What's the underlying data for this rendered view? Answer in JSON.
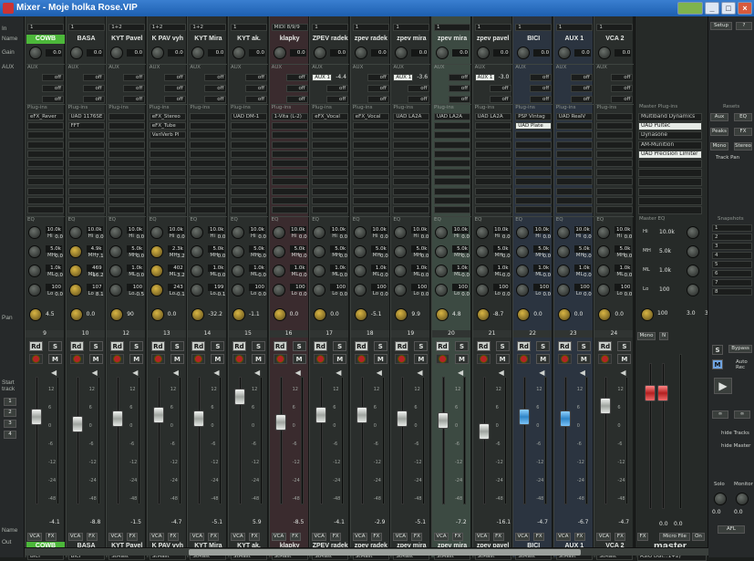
{
  "window": {
    "title": "Mixer - Moje holka Rose.VIP"
  },
  "row_labels": {
    "in": "In",
    "name": "Name",
    "gain": "Gain",
    "aux": "AUX",
    "pan": "Pan",
    "start_track": "Start track",
    "out": "Out",
    "name_bottom": "Name"
  },
  "start_track_numbers": [
    "1",
    "2",
    "3",
    "4"
  ],
  "section_labels": {
    "aux": "AUX",
    "plugins": "Plug-ins",
    "eq": "EQ",
    "master_plugins": "Master Plug-ins",
    "resets": "Resets",
    "master_eq": "Master EQ",
    "snapshots": "Snapshots"
  },
  "channels": [
    {
      "input": "1",
      "name": "COWB",
      "gain": "0.0",
      "aux": [
        "off",
        "off",
        "off"
      ],
      "plugins": [
        "eFX_Rever",
        "",
        ""
      ],
      "eq_vals": [
        "10.0k",
        "5.0k",
        "1.0k",
        "100"
      ],
      "eq_gain": [
        "0.0",
        "0.0",
        "0.0",
        "0.0"
      ],
      "pan": "4.5",
      "num": "9",
      "vol": "-4.1",
      "out": "BICI"
    },
    {
      "input": "1",
      "name": "BASA",
      "gain": "0.0",
      "aux": [
        "off",
        "off",
        "off"
      ],
      "plugins": [
        "UAD 1176SE",
        "FFT",
        ""
      ],
      "eq_vals": [
        "10.0k",
        "4.9k",
        "469",
        "107"
      ],
      "eq_gain": [
        "0.0",
        "7.1",
        "-16.2",
        "8.1"
      ],
      "pan": "0.0",
      "num": "10",
      "vol": "-8.8",
      "out": "BICI"
    },
    {
      "input": "1+2",
      "name": "KYT Pavel",
      "gain": "0.0",
      "aux": [
        "off",
        "off",
        "off"
      ],
      "plugins": [
        "",
        "",
        ""
      ],
      "eq_vals": [
        "10.0k",
        "5.0k",
        "1.0k",
        "100"
      ],
      "eq_gain": [
        "0.0",
        "0.0",
        "0.0",
        "-0.5"
      ],
      "pan": "90",
      "num": "12",
      "vol": "-1.5",
      "out": "StMast"
    },
    {
      "input": "1+2",
      "name": "K PAV vyh",
      "gain": "0.0",
      "aux": [
        "off",
        "off",
        "off"
      ],
      "plugins": [
        "eFX_Stereo",
        "eFX_Tube",
        "VariVerb Pl"
      ],
      "eq_vals": [
        "10.0k",
        "2.3k",
        "402",
        "243"
      ],
      "eq_gain": [
        "0.0",
        "3.2",
        "3.2",
        "-0.1"
      ],
      "pan": "0.0",
      "num": "13",
      "vol": "-4.7",
      "out": "StMast"
    },
    {
      "input": "1+2",
      "name": "KYT Mira",
      "gain": "0.0",
      "aux": [
        "off",
        "off",
        "off"
      ],
      "plugins": [
        "",
        "",
        ""
      ],
      "eq_vals": [
        "10.0k",
        "5.0k",
        "1.0k",
        "199"
      ],
      "eq_gain": [
        "0.0",
        "0.0",
        "0.0",
        "-0.1"
      ],
      "pan": "-32.2",
      "num": "14",
      "vol": "-5.1",
      "out": "StMast"
    },
    {
      "input": "1",
      "name": "KYT ak.",
      "gain": "0.0",
      "aux": [
        "off",
        "off",
        "off"
      ],
      "plugins": [
        "UAD DM-1",
        "",
        ""
      ],
      "eq_vals": [
        "10.0k",
        "5.0k",
        "1.0k",
        "100"
      ],
      "eq_gain": [
        "0.0",
        "0.0",
        "0.0",
        "0.0"
      ],
      "pan": "-1.1",
      "num": "15",
      "vol": "5.9",
      "out": "StMast"
    },
    {
      "input": "MIDI 8/9/9",
      "name": "klapky",
      "gain": "0.0",
      "aux": [
        "off",
        "off",
        "off"
      ],
      "plugins": [
        "1-Vita (L-2)",
        "",
        ""
      ],
      "eq_vals": [
        "10.0k",
        "5.0k",
        "1.0k",
        "100"
      ],
      "eq_gain": [
        "0.0",
        "0.0",
        "0.0",
        "0.0"
      ],
      "pan": "0.0",
      "num": "16",
      "vol": "-8.5",
      "out": "StMast"
    },
    {
      "input": "1",
      "name": "ZPEV radek",
      "gain": "0.0",
      "aux": [
        "AUX 1",
        "off",
        "off"
      ],
      "aux1_val": "-4.4",
      "plugins": [
        "eFX_Vocal",
        "",
        ""
      ],
      "eq_vals": [
        "10.0k",
        "5.0k",
        "1.0k",
        "100"
      ],
      "eq_gain": [
        "0.0",
        "0.0",
        "0.0",
        "0.0"
      ],
      "pan": "0.0",
      "num": "17",
      "vol": "-4.1",
      "out": "StMast"
    },
    {
      "input": "1",
      "name": "zpev radek",
      "gain": "0.0",
      "aux": [
        "off",
        "off",
        "off"
      ],
      "plugins": [
        "eFX_Vocal",
        "",
        ""
      ],
      "eq_vals": [
        "10.0k",
        "5.0k",
        "1.0k",
        "100"
      ],
      "eq_gain": [
        "0.0",
        "0.0",
        "0.0",
        "0.0"
      ],
      "pan": "-5.1",
      "num": "18",
      "vol": "-2.9",
      "out": "StMast"
    },
    {
      "input": "1",
      "name": "zpev mira",
      "gain": "0.0",
      "aux": [
        "AUX 1",
        "off",
        "off"
      ],
      "aux1_val": "-3.6",
      "plugins": [
        "UAD LA2A",
        "",
        ""
      ],
      "eq_vals": [
        "10.0k",
        "5.0k",
        "1.0k",
        "100"
      ],
      "eq_gain": [
        "0.0",
        "0.0",
        "0.0",
        "0.0"
      ],
      "pan": "9.9",
      "num": "19",
      "vol": "-5.1",
      "out": "StMast"
    },
    {
      "input": "1",
      "name": "zpev mira",
      "gain": "0.0",
      "aux": [
        "off",
        "off",
        "off"
      ],
      "plugins": [
        "UAD LA2A",
        "",
        ""
      ],
      "eq_vals": [
        "10.0k",
        "5.0k",
        "1.0k",
        "100"
      ],
      "eq_gain": [
        "0.0",
        "0.0",
        "0.0",
        "0.0"
      ],
      "pan": "4.8",
      "num": "20",
      "vol": "-7.2",
      "out": "StMast"
    },
    {
      "input": "1",
      "name": "zpev pavel",
      "gain": "0.0",
      "aux": [
        "AUX 1",
        "off",
        "off"
      ],
      "aux1_val": "-3.0",
      "plugins": [
        "UAD LA2A",
        "",
        ""
      ],
      "eq_vals": [
        "10.0k",
        "5.0k",
        "1.0k",
        "100"
      ],
      "eq_gain": [
        "0.0",
        "0.0",
        "0.0",
        "0.0"
      ],
      "pan": "-8.7",
      "num": "21",
      "vol": "-16.1",
      "out": "StMast"
    },
    {
      "input": "1",
      "name": "BICI",
      "gain": "0.0",
      "aux": [
        "off",
        "off",
        "off"
      ],
      "plugins": [
        "PSP Vintag",
        "UAD Plate",
        ""
      ],
      "eq_vals": [
        "10.0k",
        "5.0k",
        "1.0k",
        "100"
      ],
      "eq_gain": [
        "0.0",
        "0.0",
        "0.0",
        "0.0"
      ],
      "pan": "0.0",
      "num": "22",
      "vol": "-4.7",
      "out": "StMast"
    },
    {
      "input": "1",
      "name": "AUX 1",
      "gain": "0.0",
      "aux": [
        "off",
        "off",
        "off"
      ],
      "plugins": [
        "UAD RealV",
        "",
        ""
      ],
      "eq_vals": [
        "10.0k",
        "5.0k",
        "1.0k",
        "100"
      ],
      "eq_gain": [
        "0.0",
        "0.0",
        "0.0",
        "0.0"
      ],
      "pan": "0.0",
      "num": "23",
      "vol": "-6.7",
      "out": "StMast"
    },
    {
      "input": "1",
      "name": "VCA 2",
      "gain": "0.0",
      "aux": [
        "off",
        "off",
        "off"
      ],
      "plugins": [
        "",
        "",
        ""
      ],
      "eq_vals": [
        "10.0k",
        "5.0k",
        "1.0k",
        "100"
      ],
      "eq_gain": [
        "0.0",
        "0.0",
        "0.0",
        "0.0"
      ],
      "pan": "0.0",
      "num": "24",
      "vol": "-4.7",
      "out": "StMast"
    }
  ],
  "strip_buttons": {
    "rd": "Rd",
    "s": "S",
    "m": "M",
    "vca": "VCA",
    "fx": "FX",
    "i21": "I21"
  },
  "fader_scale": [
    "12",
    "6",
    "0",
    "-6",
    "-12",
    "-24",
    "-48"
  ],
  "master": {
    "label": "master",
    "plugins_header": "Master Plug-ins",
    "plugins": [
      "Multiband Dynamics",
      "UAD Pultec",
      "Dynasone",
      "AM-Munition",
      "UAD Precision Limiter"
    ],
    "eq": [
      {
        "band": "Hi",
        "val": "10.0k"
      },
      {
        "band": "MH",
        "val": "5.0k"
      },
      {
        "band": "ML",
        "val": "1.0k"
      },
      {
        "band": "Lo",
        "val": "100"
      }
    ],
    "pan": "100",
    "out": "ASIO DGt...1+2)",
    "mono": "Mono",
    "n": "N",
    "micro_file": "Micro File",
    "on": "On",
    "vals": [
      "3.0",
      "3.5"
    ],
    "levels": [
      "0.0",
      "0.0"
    ]
  },
  "right": {
    "setup": "Setup",
    "help": "?",
    "resets": "Resets",
    "aux": "Aux",
    "eq": "EQ",
    "peaks": "Peaks",
    "fx": "FX",
    "mono": "Mono",
    "stereo": "Stereo",
    "track_pan": "Track Pan",
    "snapshots": [
      "1",
      "2",
      "3",
      "4",
      "5",
      "6",
      "7",
      "8"
    ],
    "bypass": "Bypass",
    "auto": "Auto Rec",
    "hide_tracks": "hide Tracks",
    "hide_master": "hide Master",
    "solo": "Solo",
    "monitor": "Monitor",
    "afl": "AFL",
    "solo_vals": [
      "0.0",
      "0.0"
    ]
  },
  "colors": {
    "name_green": "#4cb83a",
    "rec_red": "#b32424",
    "fader_blue": "#2f86c8",
    "fader_red": "#b42020",
    "highlight": "#3c4a42"
  }
}
